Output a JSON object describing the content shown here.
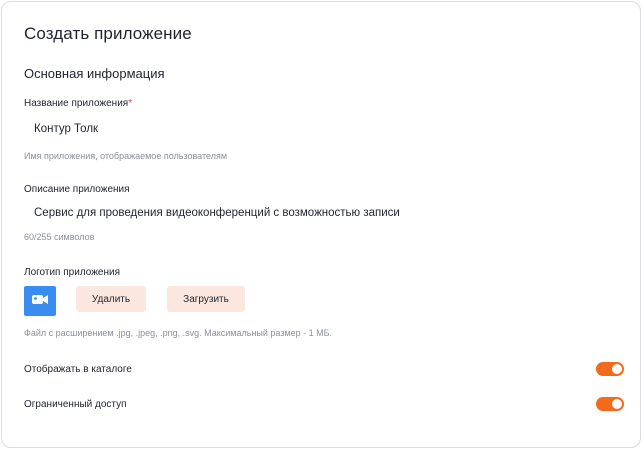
{
  "page": {
    "title": "Создать приложение",
    "section_title": "Основная информация"
  },
  "app_name": {
    "label": "Название приложения",
    "required_mark": "*",
    "value": "Контур Толк",
    "hint": "Имя приложения, отображаемое пользователям"
  },
  "app_description": {
    "label": "Описание приложения",
    "value": "Сервис для проведения видеоконференций с возможностью записи",
    "counter": "60/255 символов"
  },
  "logo": {
    "label": "Логотип приложения",
    "icon": "video-camera-icon",
    "tile_color": "#3a8df0",
    "delete_label": "Удалить",
    "upload_label": "Загрузить",
    "hint": "Файл с расширением .jpg, .jpeg, .png, .svg. Максимальный размер - 1 МБ."
  },
  "settings": {
    "show_in_catalog": {
      "label": "Отображать в каталоге",
      "enabled": true
    },
    "restricted_access": {
      "label": "Ограниченный доступ",
      "enabled": true
    }
  },
  "colors": {
    "accent": "#f26b1d",
    "button_bg": "#fbe7de",
    "required": "#e8452f"
  }
}
